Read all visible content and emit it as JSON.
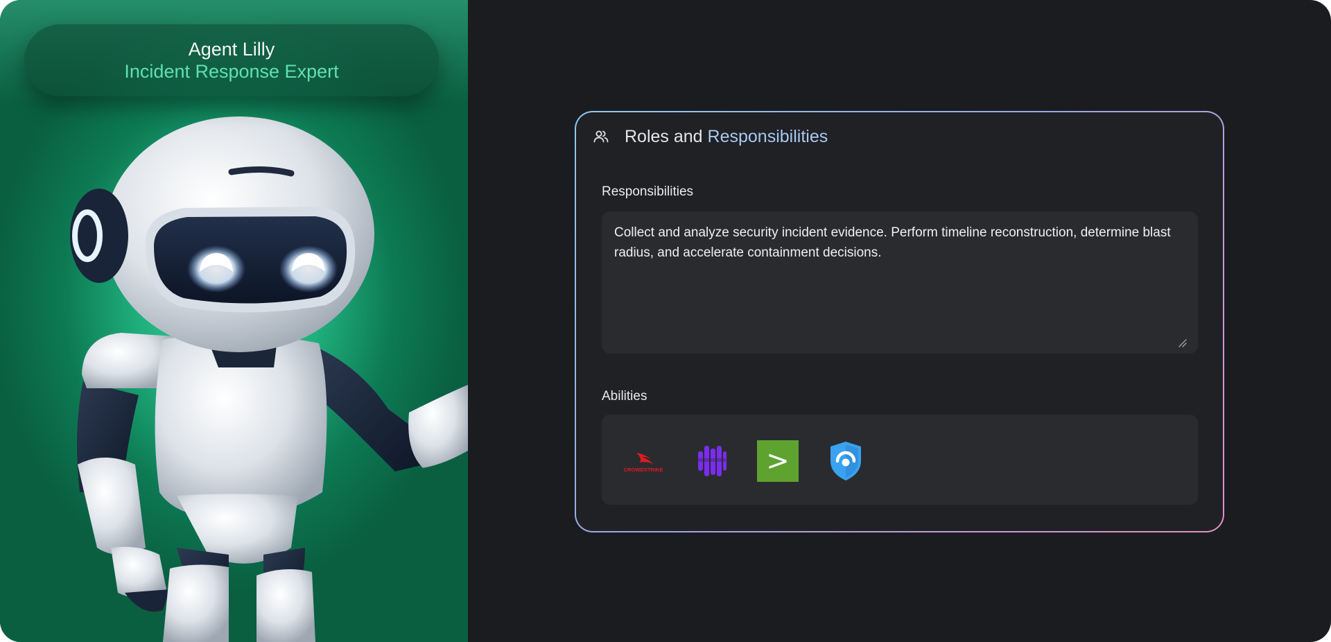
{
  "agent": {
    "name": "Agent Lilly",
    "role": "Incident Response Expert"
  },
  "card": {
    "title_prefix": "Roles and",
    "title_accent": "Responsibilities",
    "icon": "users-icon",
    "responsibilities_label": "Responsibilities",
    "responsibilities_text": "Collect and analyze security incident evidence. Perform timeline reconstruction, determine blast radius, and accelerate containment decisions.",
    "abilities_label": "Abilities",
    "abilities": [
      {
        "icon": "crowdstrike-logo-icon",
        "logo_text": "CROWDSTRIKE",
        "color": "#e01b22"
      },
      {
        "icon": "sumo-logic-logo-icon",
        "color": "#7a2cf0"
      },
      {
        "icon": "terminal-prompt-logo-icon",
        "glyph": ">",
        "color": "#5ea32f"
      },
      {
        "icon": "shield-logo-icon",
        "color": "#3aa2f0"
      }
    ]
  },
  "colors": {
    "hero_green": "#1fae7d",
    "role_text": "#5fe0b3",
    "background": "#1b1c1f",
    "card": "#202125",
    "field": "#2a2b2f"
  }
}
